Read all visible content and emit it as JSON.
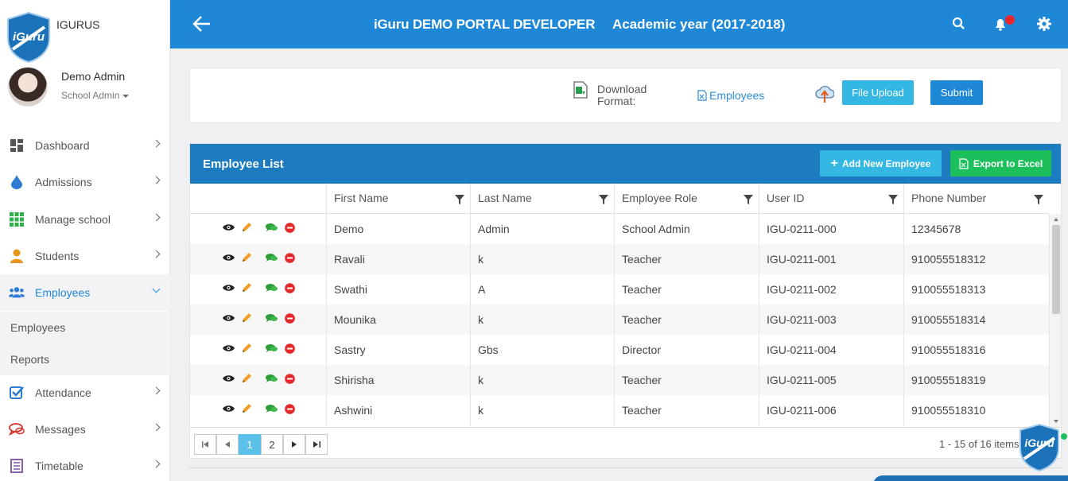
{
  "brand": {
    "name": "IGURUS",
    "logo_text": "iGuru"
  },
  "user": {
    "name": "Demo Admin",
    "role": "School Admin"
  },
  "sidebar": {
    "items": [
      {
        "label": "Dashboard",
        "icon": "dashboard-icon"
      },
      {
        "label": "Admissions",
        "icon": "drop-icon"
      },
      {
        "label": "Manage school",
        "icon": "grid-icon"
      },
      {
        "label": "Students",
        "icon": "student-icon"
      },
      {
        "label": "Employees",
        "icon": "users-icon",
        "expanded": true
      },
      {
        "label": "Attendance",
        "icon": "checkbox-icon"
      },
      {
        "label": "Messages",
        "icon": "chat-icon"
      },
      {
        "label": "Timetable",
        "icon": "list-icon"
      }
    ],
    "sub_items": [
      "Employees",
      "Reports"
    ]
  },
  "header": {
    "title": "iGuru DEMO PORTAL DEVELOPER",
    "academic_year": "Academic year (2017-2018)"
  },
  "upload": {
    "download_label_line1": "Download",
    "download_label_line2": "Format:",
    "format_link": "Employees",
    "file_upload_button": "File Upload",
    "submit_button": "Submit"
  },
  "grid": {
    "title": "Employee List",
    "add_button": "Add New Employee",
    "export_button": "Export to Excel",
    "columns": [
      "First Name",
      "Last Name",
      "Employee Role",
      "User ID",
      "Phone Number"
    ],
    "rows": [
      [
        "Demo",
        "Admin",
        "School Admin",
        "IGU-0211-000",
        "12345678"
      ],
      [
        "Ravali",
        "k",
        "Teacher",
        "IGU-0211-001",
        "910055518312"
      ],
      [
        "Swathi",
        "A",
        "Teacher",
        "IGU-0211-002",
        "910055518313"
      ],
      [
        "Mounika",
        "k",
        "Teacher",
        "IGU-0211-003",
        "910055518314"
      ],
      [
        "Sastry",
        "Gbs",
        "Director",
        "IGU-0211-004",
        "910055518316"
      ],
      [
        "Shirisha",
        "k",
        "Teacher",
        "IGU-0211-005",
        "910055518319"
      ],
      [
        "Ashwini",
        "k",
        "Teacher",
        "IGU-0211-006",
        "910055518310"
      ]
    ],
    "pager": {
      "pages": [
        "1",
        "2"
      ],
      "current": "1",
      "info": "1 - 15 of 16 items"
    }
  },
  "colors": {
    "primary": "#1e88d6",
    "grid_bar": "#1d7cc0",
    "accent_cyan": "#35b7e3",
    "success": "#1cbf5c",
    "danger": "#e8262c"
  }
}
